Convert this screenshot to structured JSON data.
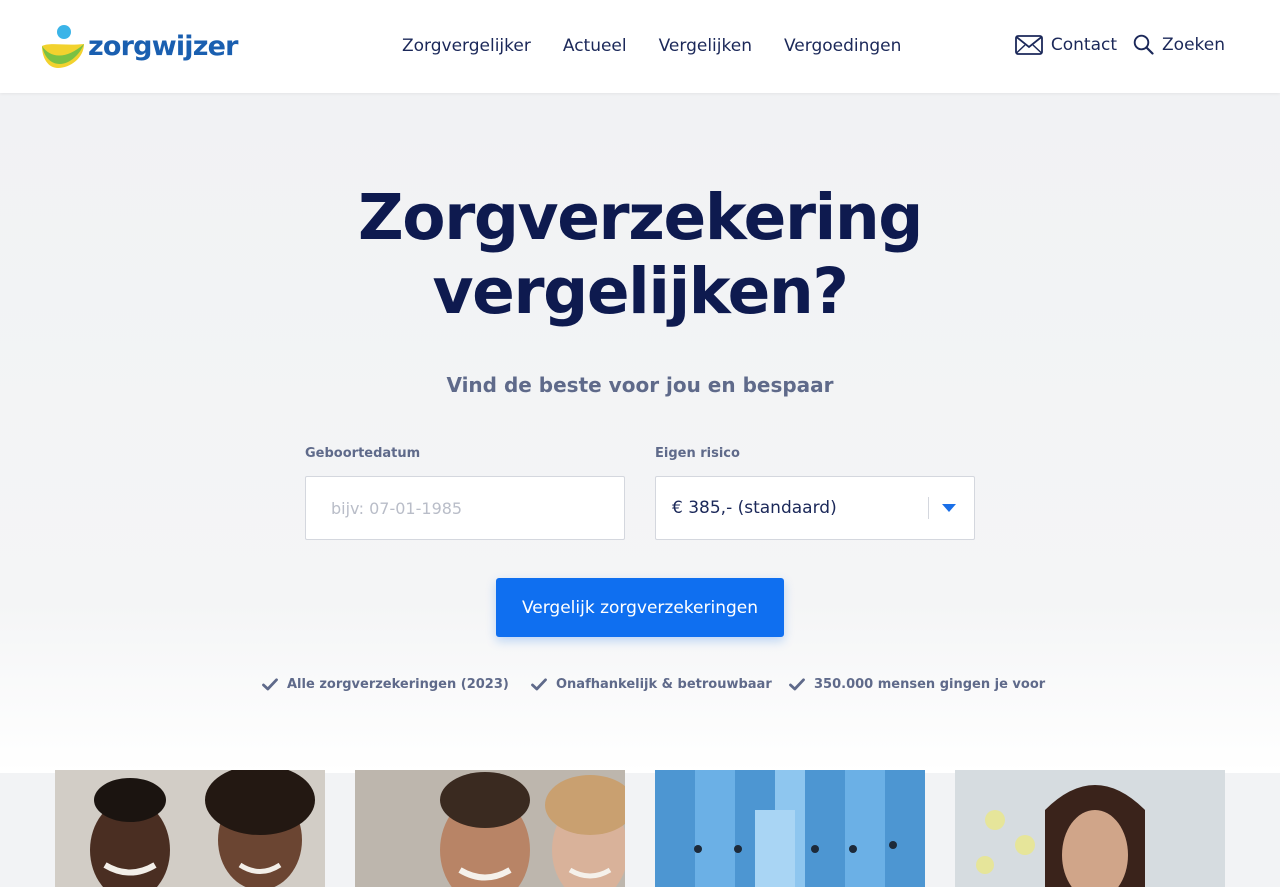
{
  "brand": {
    "name": "zorgwijzer",
    "colors": {
      "primary": "#0f6ff0",
      "navy": "#0e1a4f",
      "logo_blue": "#1a5fb0",
      "logo_yellow": "#f2d22e",
      "logo_green": "#7ac143",
      "logo_cyan": "#3bb4e8"
    }
  },
  "nav": {
    "items": [
      {
        "label": "Zorgvergelijker"
      },
      {
        "label": "Actueel"
      },
      {
        "label": "Vergelijken"
      },
      {
        "label": "Vergoedingen"
      }
    ]
  },
  "header_actions": {
    "contact": {
      "label": "Contact",
      "icon": "mail-icon"
    },
    "search": {
      "label": "Zoeken",
      "icon": "search-icon"
    }
  },
  "hero": {
    "title_line1": "Zorgverzekering",
    "title_line2": "vergelijken?",
    "subtitle": "Vind de beste voor jou en bespaar"
  },
  "form": {
    "birthdate": {
      "label": "Geboortedatum",
      "placeholder": "bijv: 07-01-1985",
      "value": ""
    },
    "deductible": {
      "label": "Eigen risico",
      "selected": "€ 385,- (standaard)"
    },
    "submit_label": "Vergelijk zorgverzekeringen"
  },
  "usps": [
    {
      "text": "Alle zorgverzekeringen (2023)",
      "icon": "check-icon"
    },
    {
      "text": "Onafhankelijk & betrouwbaar",
      "icon": "check-icon"
    },
    {
      "text": "350.000 mensen gingen je voor",
      "icon": "check-icon"
    }
  ],
  "cards": [
    {
      "image": "couple-laptop-photo"
    },
    {
      "image": "smiling-couple-photo"
    },
    {
      "image": "blue-binders-photo"
    },
    {
      "image": "woman-desk-photo"
    }
  ]
}
